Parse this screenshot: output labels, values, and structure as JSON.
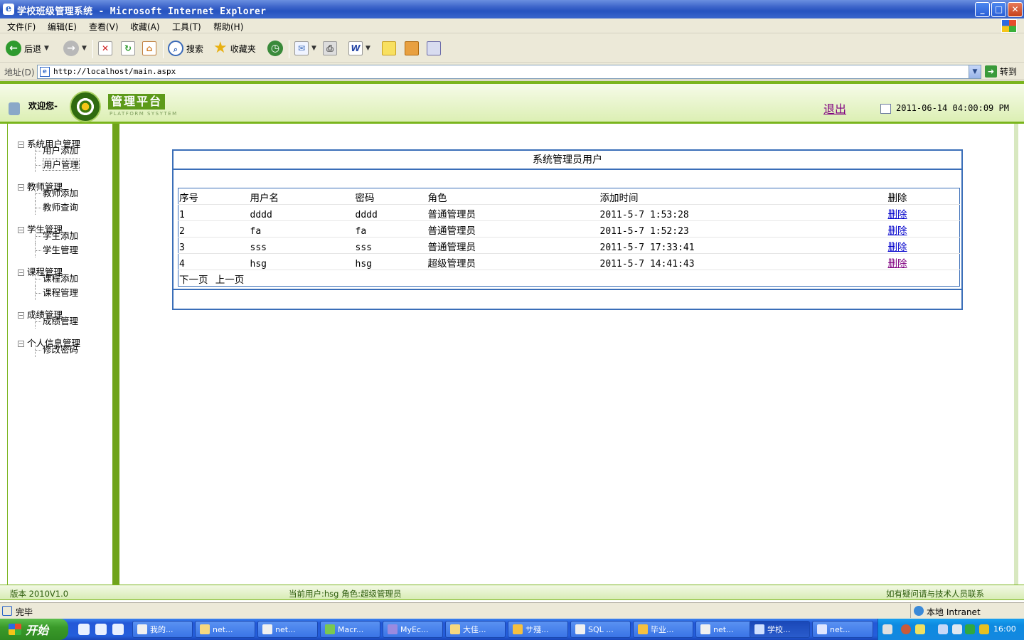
{
  "window": {
    "title": "学校班级管理系统 - Microsoft Internet Explorer",
    "buttons": {
      "minimize": "_",
      "maximize": "□",
      "close": "✕"
    }
  },
  "menu": [
    "文件(F)",
    "编辑(E)",
    "查看(V)",
    "收藏(A)",
    "工具(T)",
    "帮助(H)"
  ],
  "toolbar": {
    "back": "后退",
    "search": "搜索",
    "favorites": "收藏夹"
  },
  "address": {
    "label": "地址(D)",
    "url": "http://localhost/main.aspx",
    "go": "转到"
  },
  "header": {
    "welcome": "欢迎您-",
    "platform": "管理平台",
    "platform_sub": "PLATFORM SYSYTEM",
    "logout": "退出",
    "datetime": "2011-06-14 04:00:09 PM"
  },
  "nav": {
    "groups": [
      {
        "label": "系统用户管理",
        "children": [
          "用户添加",
          "用户管理"
        ]
      },
      {
        "label": "教师管理",
        "children": [
          "教师添加",
          "教师查询"
        ]
      },
      {
        "label": "学生管理",
        "children": [
          "学生添加",
          "学生管理"
        ]
      },
      {
        "label": "课程管理",
        "children": [
          "课程添加",
          "课程管理"
        ]
      },
      {
        "label": "成绩管理",
        "children": [
          "成绩管理"
        ]
      },
      {
        "label": "个人信息管理",
        "children": [
          "修改密码"
        ]
      }
    ],
    "selected": "用户管理"
  },
  "panel": {
    "title": "系统管理员用户",
    "columns": [
      "序号",
      "用户名",
      "密码",
      "角色",
      "添加时间",
      "删除"
    ],
    "rows": [
      {
        "id": "1",
        "username": "dddd",
        "password": "dddd",
        "role": "普通管理员",
        "added": "2011-5-7 1:53:28",
        "delete": "删除"
      },
      {
        "id": "2",
        "username": "fa",
        "password": "fa",
        "role": "普通管理员",
        "added": "2011-5-7 1:52:23",
        "delete": "删除"
      },
      {
        "id": "3",
        "username": "sss",
        "password": "sss",
        "role": "普通管理员",
        "added": "2011-5-7 17:33:41",
        "delete": "删除"
      },
      {
        "id": "4",
        "username": "hsg",
        "password": "hsg",
        "role": "超级管理员",
        "added": "2011-5-7 14:41:43",
        "delete": "删除"
      }
    ],
    "pager": {
      "next": "下一页",
      "prev": "上一页"
    }
  },
  "footer": {
    "version": "版本 2010V1.0",
    "current_user": "当前用户:hsg 角色:超级管理员",
    "help": "如有疑问请与技术人员联系"
  },
  "ie_status": {
    "done": "完毕",
    "zone": "本地 Intranet"
  },
  "taskbar": {
    "start": "开始",
    "tasks": [
      "我的...",
      "net...",
      "net...",
      "Macr...",
      "MyEc...",
      "大佳...",
      "サ殘...",
      "SQL ...",
      "毕业...",
      "net...",
      "学校...",
      "net..."
    ],
    "active_index": 10,
    "clock": "16:00"
  },
  "colors": {
    "accent_green": "#7ab51d",
    "panel_blue": "#3a6eb8",
    "link": "#0000cc",
    "visited": "#800080"
  }
}
